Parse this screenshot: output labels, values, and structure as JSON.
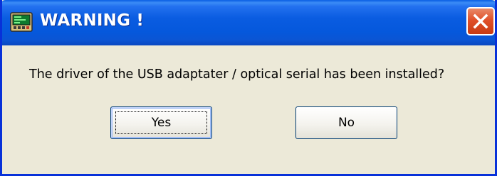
{
  "dialog": {
    "title": "WARNING !",
    "app_icon": "terminal-icon",
    "close_icon": "close-icon",
    "message": "The driver of the USB adaptater / optical serial has been installed?",
    "buttons": {
      "yes_label": "Yes",
      "no_label": "No",
      "default_button": "Yes"
    }
  },
  "colors": {
    "titlebar": "#0558dc",
    "window_frame": "#0831d9",
    "dialog_background": "#ece9d8",
    "close_button": "#e0502a",
    "button_border": "#003c74"
  }
}
